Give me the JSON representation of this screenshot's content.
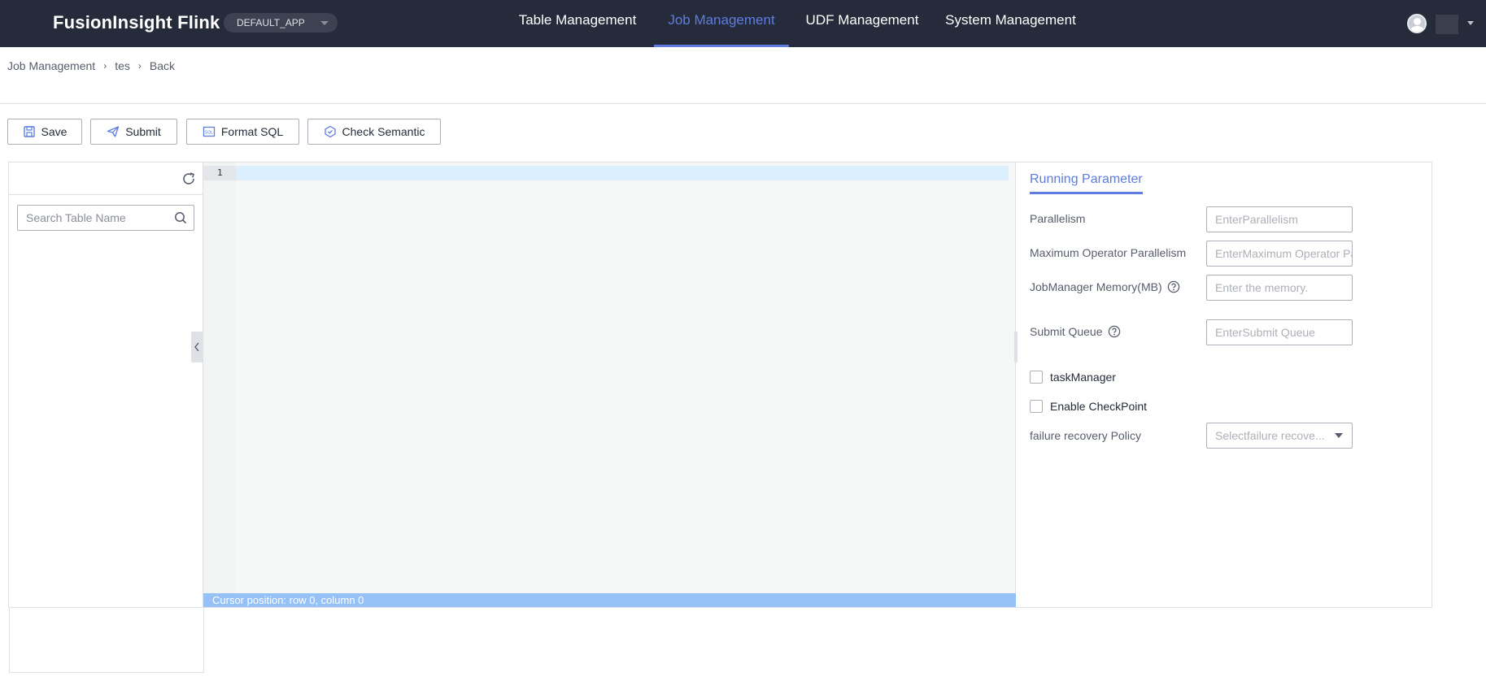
{
  "header": {
    "brand": "FusionInsight Flink",
    "app_selector": "DEFAULT_APP",
    "tabs": [
      {
        "label": "Table Management",
        "active": false
      },
      {
        "label": "Job Management",
        "active": true
      },
      {
        "label": "UDF Management",
        "active": false
      },
      {
        "label": "System Management",
        "active": false
      }
    ]
  },
  "breadcrumb": [
    "Job Management",
    "tes",
    "Back"
  ],
  "toolbar": {
    "save": "Save",
    "submit": "Submit",
    "format_sql": "Format SQL",
    "check_semantic": "Check Semantic"
  },
  "left_panel": {
    "search_placeholder": "Search Table Name"
  },
  "editor": {
    "line_number": "1",
    "status": "Cursor position: row 0, column 0"
  },
  "right_panel": {
    "title": "Running Parameter",
    "fields": {
      "parallelism": {
        "label": "Parallelism",
        "placeholder": "EnterParallelism"
      },
      "max_op_parallelism": {
        "label": "Maximum Operator Parallelism",
        "placeholder": "EnterMaximum Operator Parallelism"
      },
      "jobmanager_memory": {
        "label": "JobManager Memory(MB)",
        "placeholder": "Enter the memory."
      },
      "submit_queue": {
        "label": "Submit Queue",
        "placeholder": "EnterSubmit Queue"
      }
    },
    "checkboxes": {
      "task_manager": "taskManager",
      "enable_checkpoint": "Enable CheckPoint"
    },
    "failure_policy": {
      "label": "failure recovery Policy",
      "placeholder": "Selectfailure recove..."
    }
  },
  "colors": {
    "topbar": "#252b3a",
    "accent": "#5e7ce0",
    "status_bar": "#96c1f7"
  }
}
